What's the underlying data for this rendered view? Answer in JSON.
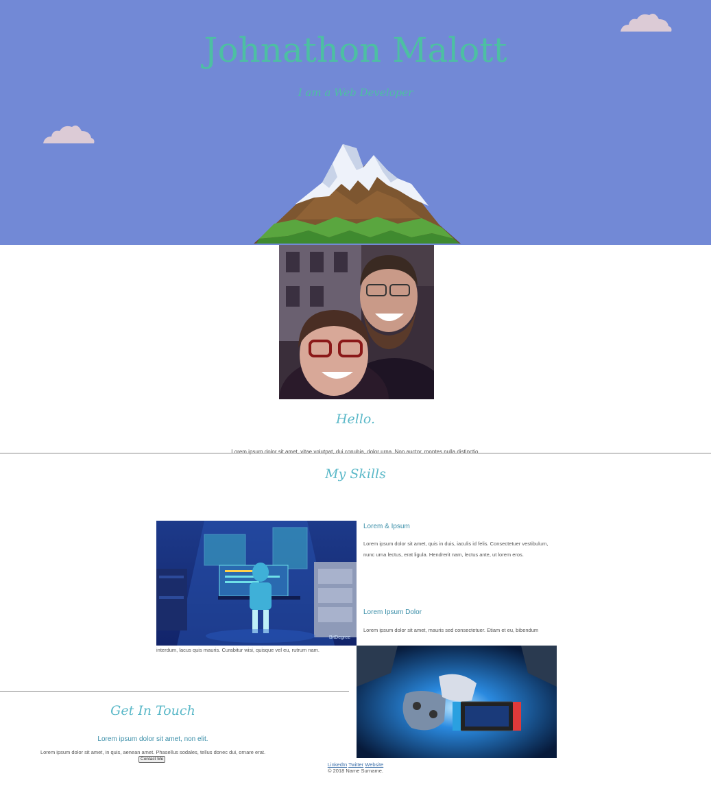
{
  "hero": {
    "title": "Johnathon Malott",
    "subtitle": "I am a Web Developer",
    "background": "#7289d6",
    "title_color": "#4dbfa3"
  },
  "about": {
    "heading": "Hello.",
    "text": "Lorem ipsum dolor sit amet, vitae volutpat, dui conubia, dolor urna. Non auctor, montes nulla distinctio."
  },
  "skills": {
    "heading": "My Skills",
    "items": [
      {
        "title": "Lorem & Ipsum",
        "text": "Lorem ipsum dolor sit amet, quis in duis, iaculis id felis. Consectetuer vestibulum, nunc urna lectus, erat ligula. Hendrerit nam, lectus ante, ut lorem eros.",
        "image": "developer-at-computer-illustration"
      },
      {
        "title": "Lorem Ipsum Dolor",
        "text_line1": "Lorem ipsum dolor sit amet, mauris sed consectetuer. Etiam et eu, bibendum",
        "text_line2": "interdum, lacus quis mauris. Curabitur wisi, quisque vel eu, rutrum nam.",
        "image": "game-controllers-photo",
        "image_caption": "BitDegree"
      }
    ]
  },
  "contact": {
    "heading": "Get In Touch",
    "subheading": "Lorem ipsum dolor sit amet, non elit.",
    "text": "Lorem ipsum dolor sit amet, in quis, aenean amet. Phasellus sodales, tellus donec dui, ornare erat.",
    "button_label": "Contact Me"
  },
  "footer": {
    "links": [
      "LinkedIn",
      "Twitter",
      "Website"
    ],
    "copyright": "© 2018 Name Surname."
  }
}
